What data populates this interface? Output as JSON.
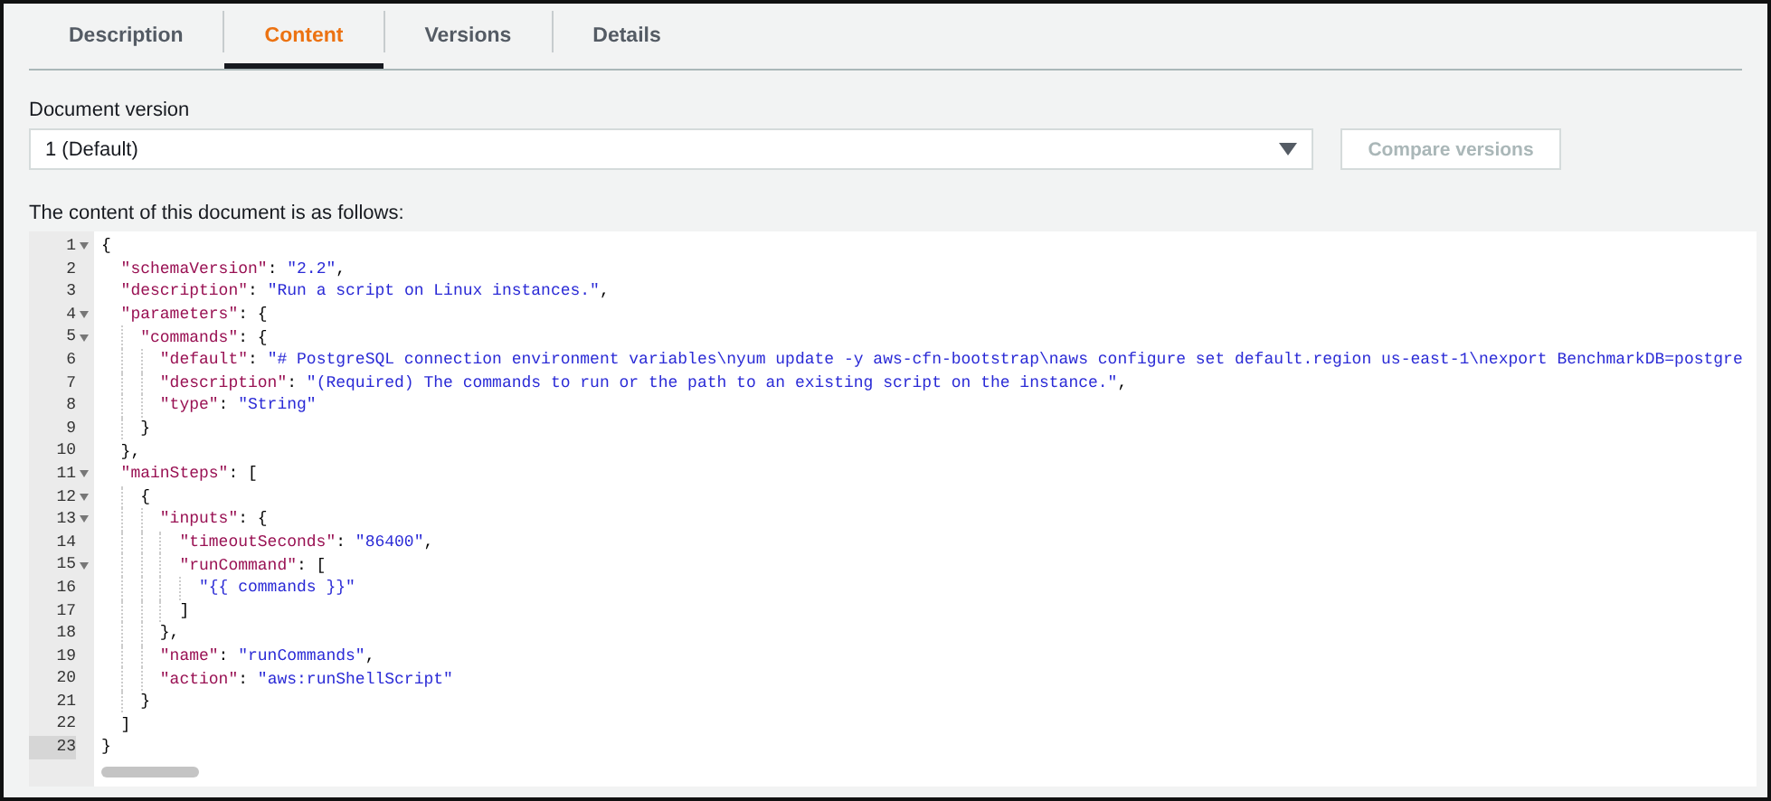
{
  "tabs": [
    {
      "label": "Description",
      "selected": false
    },
    {
      "label": "Content",
      "selected": true
    },
    {
      "label": "Versions",
      "selected": false
    },
    {
      "label": "Details",
      "selected": false
    }
  ],
  "version_select": {
    "label": "Document version",
    "value": "1 (Default)"
  },
  "compare_button": {
    "label": "Compare versions",
    "disabled": true
  },
  "content_label": "The content of this document is as follows:",
  "editor": {
    "lines": [
      {
        "number": "1",
        "active": false,
        "tokens": [
          {
            "kind": "punct",
            "text": "{"
          }
        ],
        "children": [
          {
            "number": "2",
            "active": false,
            "tokens": [
              {
                "kind": "key",
                "text": "\"schemaVersion\""
              },
              {
                "kind": "punct",
                "text": ": "
              },
              {
                "kind": "string",
                "text": "\"2.2\""
              },
              {
                "kind": "punct",
                "text": ","
              }
            ]
          },
          {
            "number": "3",
            "active": false,
            "tokens": [
              {
                "kind": "key",
                "text": "\"description\""
              },
              {
                "kind": "punct",
                "text": ": "
              },
              {
                "kind": "string",
                "text": "\"Run a script on Linux instances.\""
              },
              {
                "kind": "punct",
                "text": ","
              }
            ]
          },
          {
            "number": "4",
            "active": false,
            "tokens": [
              {
                "kind": "key",
                "text": "\"parameters\""
              },
              {
                "kind": "punct",
                "text": ": {"
              }
            ],
            "children": [
              {
                "number": "5",
                "active": false,
                "tokens": [
                  {
                    "kind": "key",
                    "text": "\"commands\""
                  },
                  {
                    "kind": "punct",
                    "text": ": {"
                  }
                ],
                "children": [
                  {
                    "number": "6",
                    "active": false,
                    "tokens": [
                      {
                        "kind": "key",
                        "text": "\"default\""
                      },
                      {
                        "kind": "punct",
                        "text": ": "
                      },
                      {
                        "kind": "string",
                        "text": "\"# PostgreSQL connection environment variables\\nyum update -y aws-cfn-bootstrap\\naws configure set default.region us-east-1\\nexport BenchmarkDB=postgre"
                      }
                    ]
                  },
                  {
                    "number": "7",
                    "active": false,
                    "tokens": [
                      {
                        "kind": "key",
                        "text": "\"description\""
                      },
                      {
                        "kind": "punct",
                        "text": ": "
                      },
                      {
                        "kind": "string",
                        "text": "\"(Required) The commands to run or the path to an existing script on the instance.\""
                      },
                      {
                        "kind": "punct",
                        "text": ","
                      }
                    ]
                  },
                  {
                    "number": "8",
                    "active": false,
                    "tokens": [
                      {
                        "kind": "key",
                        "text": "\"type\""
                      },
                      {
                        "kind": "punct",
                        "text": ": "
                      },
                      {
                        "kind": "string",
                        "text": "\"String\""
                      }
                    ]
                  }
                ]
              },
              {
                "number": "9",
                "active": false,
                "tokens": [
                  {
                    "kind": "punct",
                    "text": "}"
                  }
                ]
              }
            ]
          },
          {
            "number": "10",
            "active": false,
            "tokens": [
              {
                "kind": "punct",
                "text": "},"
              }
            ]
          },
          {
            "number": "11",
            "active": false,
            "tokens": [
              {
                "kind": "key",
                "text": "\"mainSteps\""
              },
              {
                "kind": "punct",
                "text": ": ["
              }
            ],
            "children": [
              {
                "number": "12",
                "active": false,
                "tokens": [
                  {
                    "kind": "punct",
                    "text": "{"
                  }
                ],
                "children": [
                  {
                    "number": "13",
                    "active": false,
                    "tokens": [
                      {
                        "kind": "key",
                        "text": "\"inputs\""
                      },
                      {
                        "kind": "punct",
                        "text": ": {"
                      }
                    ],
                    "children": [
                      {
                        "number": "14",
                        "active": false,
                        "tokens": [
                          {
                            "kind": "key",
                            "text": "\"timeoutSeconds\""
                          },
                          {
                            "kind": "punct",
                            "text": ": "
                          },
                          {
                            "kind": "string",
                            "text": "\"86400\""
                          },
                          {
                            "kind": "punct",
                            "text": ","
                          }
                        ]
                      },
                      {
                        "number": "15",
                        "active": false,
                        "tokens": [
                          {
                            "kind": "key",
                            "text": "\"runCommand\""
                          },
                          {
                            "kind": "punct",
                            "text": ": ["
                          }
                        ],
                        "children": [
                          {
                            "number": "16",
                            "active": false,
                            "tokens": [
                              {
                                "kind": "string",
                                "text": "\"{{ commands }}\""
                              }
                            ]
                          }
                        ]
                      },
                      {
                        "number": "17",
                        "active": false,
                        "tokens": [
                          {
                            "kind": "punct",
                            "text": "]"
                          }
                        ]
                      }
                    ]
                  },
                  {
                    "number": "18",
                    "active": false,
                    "tokens": [
                      {
                        "kind": "punct",
                        "text": "},"
                      }
                    ]
                  },
                  {
                    "number": "19",
                    "active": false,
                    "tokens": [
                      {
                        "kind": "key",
                        "text": "\"name\""
                      },
                      {
                        "kind": "punct",
                        "text": ": "
                      },
                      {
                        "kind": "string",
                        "text": "\"runCommands\""
                      },
                      {
                        "kind": "punct",
                        "text": ","
                      }
                    ]
                  },
                  {
                    "number": "20",
                    "active": false,
                    "tokens": [
                      {
                        "kind": "key",
                        "text": "\"action\""
                      },
                      {
                        "kind": "punct",
                        "text": ": "
                      },
                      {
                        "kind": "string",
                        "text": "\"aws:runShellScript\""
                      }
                    ]
                  }
                ]
              },
              {
                "number": "21",
                "active": false,
                "tokens": [
                  {
                    "kind": "punct",
                    "text": "}"
                  }
                ]
              }
            ]
          },
          {
            "number": "22",
            "active": false,
            "tokens": [
              {
                "kind": "punct",
                "text": "]"
              }
            ]
          }
        ]
      },
      {
        "number": "23",
        "active": true,
        "tokens": [
          {
            "kind": "punct",
            "text": "}"
          }
        ]
      }
    ]
  }
}
